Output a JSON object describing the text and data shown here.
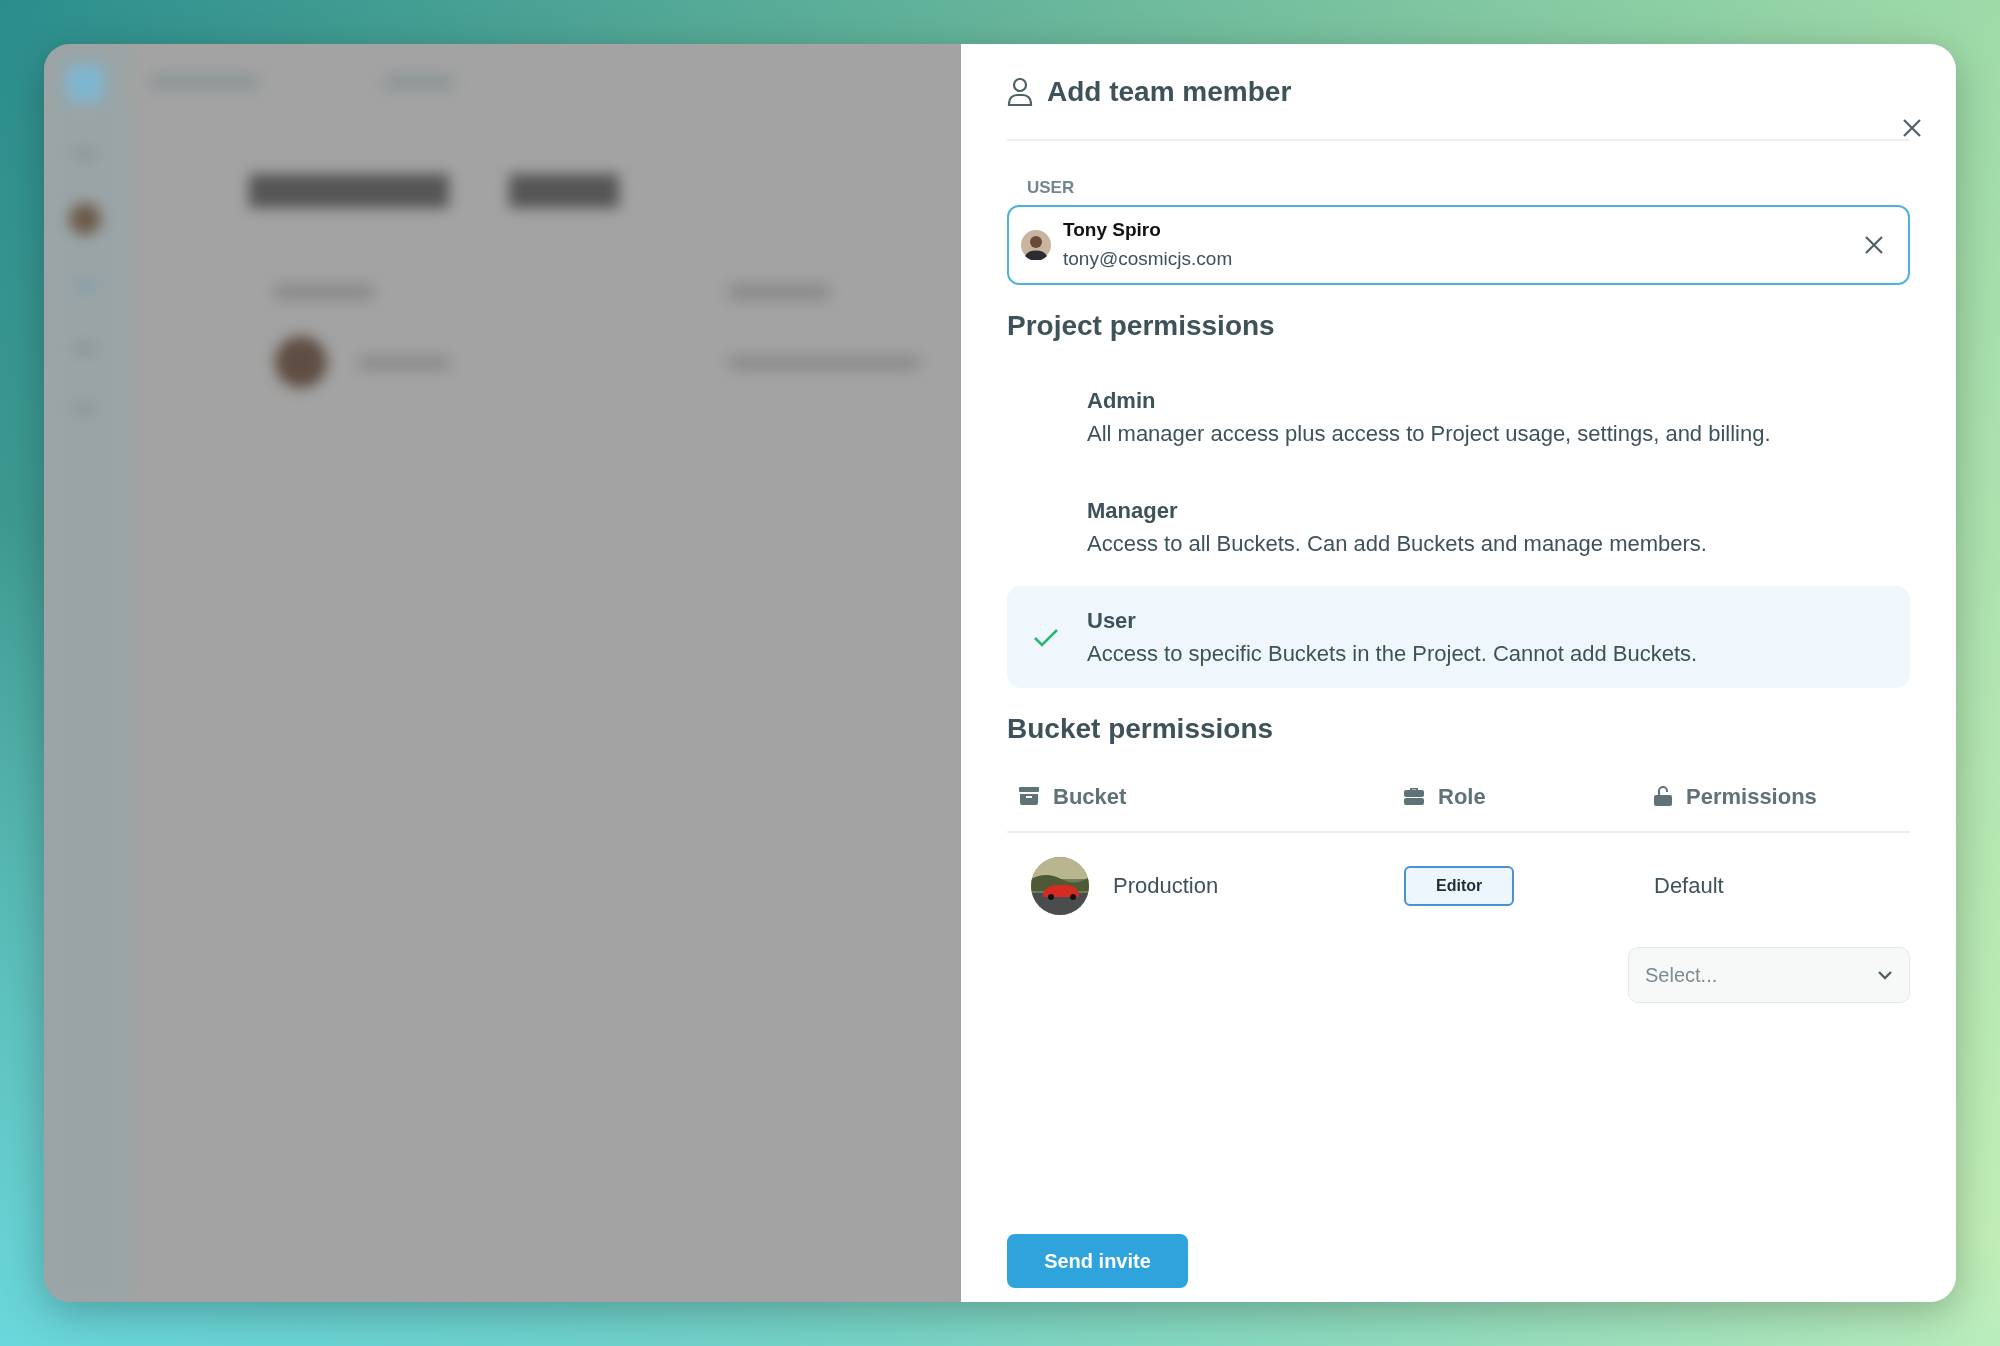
{
  "dialog": {
    "title": "Add team member",
    "user_field": {
      "label": "USER",
      "name": "Tony Spiro",
      "email": "tony@cosmicjs.com"
    },
    "project_permissions": {
      "heading": "Project permissions",
      "options": [
        {
          "title": "Admin",
          "description": "All manager access plus access to Project usage, settings, and billing.",
          "selected": false
        },
        {
          "title": "Manager",
          "description": "Access to all Buckets. Can add Buckets and manage members.",
          "selected": false
        },
        {
          "title": "User",
          "description": "Access to specific Buckets in the Project. Cannot add Buckets.",
          "selected": true
        }
      ]
    },
    "bucket_permissions": {
      "heading": "Bucket permissions",
      "columns": [
        {
          "label": "Bucket",
          "kind": "bucket"
        },
        {
          "label": "Role",
          "kind": "role"
        },
        {
          "label": "Permissions",
          "kind": "permissions"
        }
      ],
      "rows": [
        {
          "bucket": "Production",
          "role": "Editor",
          "permissions": "Default"
        }
      ],
      "select": {
        "placeholder": "Select..."
      }
    },
    "submit_button": "Send invite"
  }
}
